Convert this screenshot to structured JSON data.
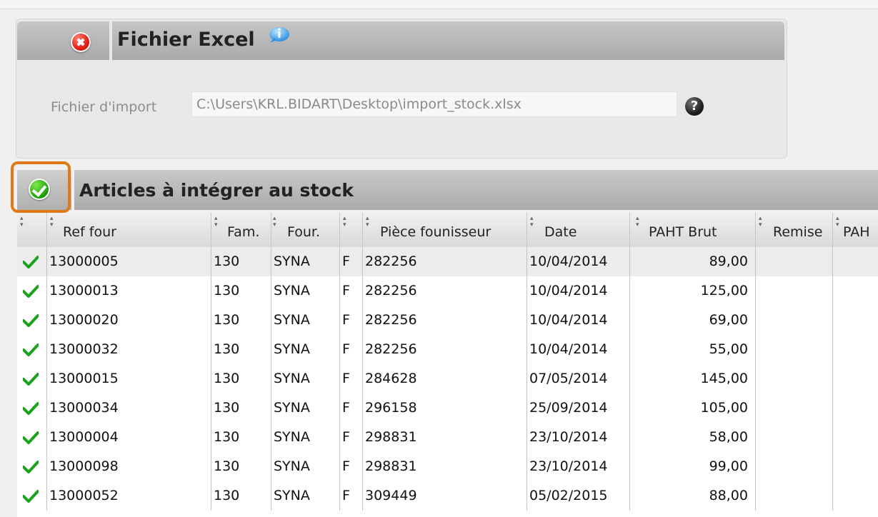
{
  "excel": {
    "title": "Fichier Excel",
    "import_label": "Fichier d'import",
    "import_value": "C:\\Users\\KRL.BIDART\\Desktop\\import_stock.xlsx",
    "help_symbol": "?"
  },
  "articles": {
    "title": "Articles à intégrer au stock"
  },
  "table": {
    "columns": [
      "Ref four",
      "Fam.",
      "Four.",
      "",
      "Pièce founisseur",
      "Date",
      "PAHT Brut",
      "Remise",
      "PAH"
    ],
    "rows": [
      {
        "ref": "13000005",
        "fam": "130",
        "four": "SYNA",
        "f": "F",
        "piece": "282256",
        "date": "10/04/2014",
        "brut": "89,00"
      },
      {
        "ref": "13000013",
        "fam": "130",
        "four": "SYNA",
        "f": "F",
        "piece": "282256",
        "date": "10/04/2014",
        "brut": "125,00"
      },
      {
        "ref": "13000020",
        "fam": "130",
        "four": "SYNA",
        "f": "F",
        "piece": "282256",
        "date": "10/04/2014",
        "brut": "69,00"
      },
      {
        "ref": "13000032",
        "fam": "130",
        "four": "SYNA",
        "f": "F",
        "piece": "282256",
        "date": "10/04/2014",
        "brut": "55,00"
      },
      {
        "ref": "13000015",
        "fam": "130",
        "four": "SYNA",
        "f": "F",
        "piece": "284628",
        "date": "07/05/2014",
        "brut": "145,00"
      },
      {
        "ref": "13000034",
        "fam": "130",
        "four": "SYNA",
        "f": "F",
        "piece": "296158",
        "date": "25/09/2014",
        "brut": "105,00"
      },
      {
        "ref": "13000004",
        "fam": "130",
        "four": "SYNA",
        "f": "F",
        "piece": "298831",
        "date": "23/10/2014",
        "brut": "58,00"
      },
      {
        "ref": "13000098",
        "fam": "130",
        "four": "SYNA",
        "f": "F",
        "piece": "298831",
        "date": "23/10/2014",
        "brut": "99,00"
      },
      {
        "ref": "13000052",
        "fam": "130",
        "four": "SYNA",
        "f": "F",
        "piece": "309449",
        "date": "05/02/2015",
        "brut": "88,00"
      }
    ]
  },
  "colors": {
    "highlight": "#e07a19",
    "check_green": "#1aa31a",
    "header_gray": "#aaaaaa"
  },
  "icons": {
    "close": "close-circle-icon",
    "info": "info-bubble-icon",
    "help": "help-icon",
    "validate": "check-circle-icon",
    "row_status": "checkmark-icon",
    "sort": "sort-icon"
  }
}
